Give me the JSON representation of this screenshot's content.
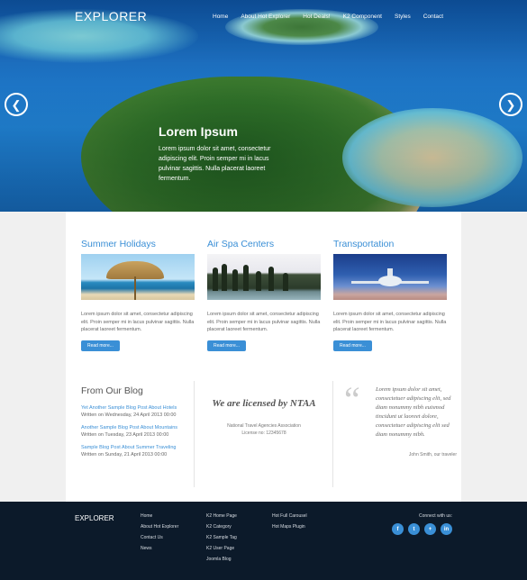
{
  "header": {
    "logo": "EXPLORER",
    "nav": [
      "Home",
      "About Hot Explorer",
      "Hot Deals!",
      "K2 Component",
      "Styles",
      "Contact"
    ]
  },
  "slider": {
    "title": "Lorem Ipsum",
    "text": "Lorem ipsum dolor sit amet, consectetur adipiscing elit. Proin semper mi in lacus pulvinar sagittis. Nulla placerat laoreet fermentum.",
    "prev_icon": "chevron-left-icon",
    "next_icon": "chevron-right-icon"
  },
  "features": [
    {
      "title": "Summer Holidays",
      "text": "Lorem ipsum dolor sit amet, consectetur adipiscing elit. Proin semper mi in lacus pulvinar sagittis. Nulla placerat laoreet fermentum.",
      "button": "Read more..."
    },
    {
      "title": "Air Spa Centers",
      "text": "Lorem ipsum dolor sit amet, consectetur adipiscing elit. Proin semper mi in lacus pulvinar sagittis. Nulla placerat laoreet fermentum.",
      "button": "Read more..."
    },
    {
      "title": "Transportation",
      "text": "Lorem ipsum dolor sit amet, consectetur adipiscing elit. Proin semper mi in lacus pulvinar sagittis. Nulla placerat laoreet fermentum.",
      "button": "Read more..."
    }
  ],
  "blog": {
    "title": "From Our Blog",
    "posts": [
      {
        "title": "Yet Another Sample Blog Post About Hotels",
        "date": "Written on Wednesday, 24 April 2013 00:00"
      },
      {
        "title": "Another Sample Blog Post About Mountains",
        "date": "Written on Tuesday, 23 April 2013 00:00"
      },
      {
        "title": "Sample Blog Post About Summer Traveling",
        "date": "Written on Sunday, 21 April 2013 00:00"
      }
    ]
  },
  "license": {
    "title": "We are licensed by NTAA",
    "association": "National Travel Agencies Association",
    "number": "License no: 12345678"
  },
  "testimonial": {
    "text": "Lorem ipsum dolor sit amet, consectetuer adipiscing elit, sed diam nonummy nibh euismod tincidunt ut laoreet dolore, consectetuer adipiscing elit sed diam nonummy nibh.",
    "author": "John Smith, our traveler"
  },
  "footer": {
    "logo": "EXPLORER",
    "col1": [
      "Home",
      "About Hot Explorer",
      "Contact Us",
      "News"
    ],
    "col2": [
      "K2 Home Page",
      "K2 Category",
      "K2 Sample Tag",
      "K2 User Page",
      "Joomla Blog"
    ],
    "col3": [
      "Hot Full Carousel",
      "Hot Maps Plugin"
    ],
    "connect_label": "Connect with us:",
    "social": [
      {
        "icon": "facebook-icon",
        "glyph": "f"
      },
      {
        "icon": "twitter-icon",
        "glyph": "t"
      },
      {
        "icon": "google-plus-icon",
        "glyph": "+"
      },
      {
        "icon": "linkedin-icon",
        "glyph": "in"
      }
    ]
  },
  "colors": {
    "accent": "#3a8fd6",
    "footer_bg": "#0c1a2a",
    "page_bg": "#f0f0f0"
  }
}
